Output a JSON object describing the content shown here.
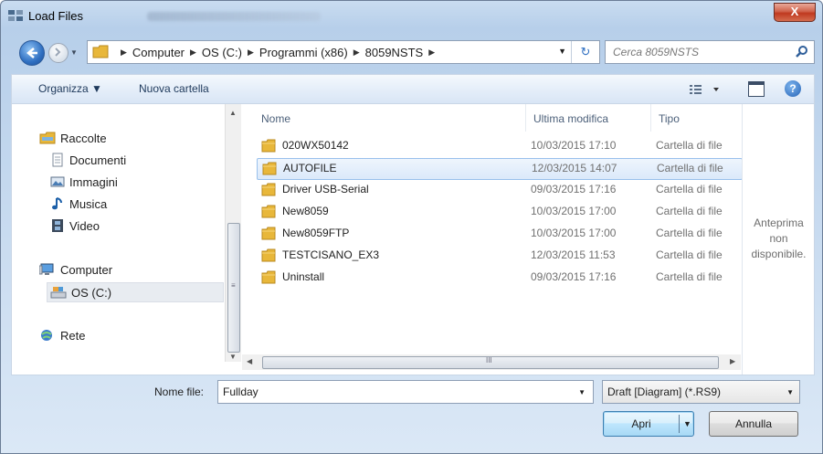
{
  "window": {
    "title": "Load Files",
    "close_label": "X"
  },
  "address": {
    "crumbs": [
      "Computer",
      "OS (C:)",
      "Programmi (x86)",
      "8059NSTS"
    ],
    "search_placeholder": "Cerca 8059NSTS"
  },
  "toolbar": {
    "organize": "Organizza ▼",
    "new_folder": "Nuova cartella"
  },
  "nav": {
    "libraries": "Raccolte",
    "documents": "Documenti",
    "pictures": "Immagini",
    "music": "Musica",
    "video": "Video",
    "computer": "Computer",
    "drive": "OS (C:)",
    "network": "Rete"
  },
  "columns": {
    "name": "Nome",
    "modified": "Ultima modifica",
    "type": "Tipo"
  },
  "files": [
    {
      "name": "020WX50142",
      "date": "10/03/2015 17:10",
      "type": "Cartella di file"
    },
    {
      "name": "AUTOFILE",
      "date": "12/03/2015 14:07",
      "type": "Cartella di file",
      "selected": true
    },
    {
      "name": "Driver USB-Serial",
      "date": "09/03/2015 17:16",
      "type": "Cartella di file"
    },
    {
      "name": "New8059",
      "date": "10/03/2015 17:00",
      "type": "Cartella di file"
    },
    {
      "name": "New8059FTP",
      "date": "10/03/2015 17:00",
      "type": "Cartella di file"
    },
    {
      "name": "TESTCISANO_EX3",
      "date": "12/03/2015 11:53",
      "type": "Cartella di file"
    },
    {
      "name": "Uninstall",
      "date": "09/03/2015 17:16",
      "type": "Cartella di file"
    }
  ],
  "preview": {
    "line1": "Anteprima",
    "line2": "non",
    "line3": "disponibile."
  },
  "footer": {
    "filename_label": "Nome file:",
    "filename_value": "Fullday",
    "filter_value": "Draft [Diagram]  (*.RS9)",
    "open_label": "Apri",
    "cancel_label": "Annulla"
  },
  "icons": {
    "folder": "folder-icon",
    "back": "back-arrow-icon",
    "forward": "forward-arrow-icon",
    "search": "search-icon",
    "help": "help-icon"
  },
  "colors": {
    "selection": "#dbe9fa",
    "folder": "#e8b73a",
    "accent": "#2f6fc1"
  }
}
